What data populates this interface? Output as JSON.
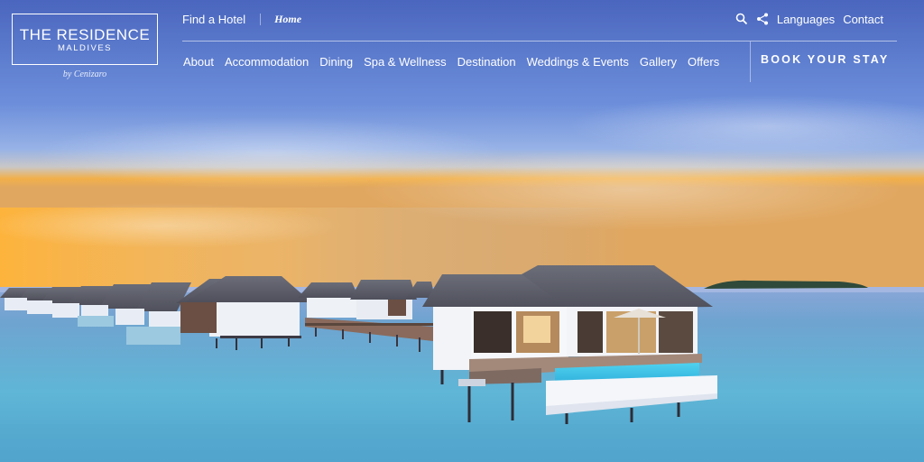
{
  "logo": {
    "title": "THE RESIDENCE",
    "subtitle": "MALDIVES",
    "byline": "by Cenizaro"
  },
  "topbar": {
    "find_hotel": "Find a Hotel",
    "breadcrumb": "Home"
  },
  "utility": {
    "languages": "Languages",
    "contact": "Contact",
    "icons": [
      "search-icon",
      "share-icon"
    ]
  },
  "nav": {
    "items": [
      {
        "label": "About"
      },
      {
        "label": "Accommodation"
      },
      {
        "label": "Dining"
      },
      {
        "label": "Spa & Wellness"
      },
      {
        "label": "Destination"
      },
      {
        "label": "Weddings & Events"
      },
      {
        "label": "Gallery"
      },
      {
        "label": "Offers"
      }
    ]
  },
  "cta": {
    "book_label": "BOOK YOUR STAY"
  },
  "colors": {
    "sky_top": "#4d6fc4",
    "sky_horizon": "#f7b24a",
    "water": "#5fb3d3",
    "text": "#ffffff"
  }
}
